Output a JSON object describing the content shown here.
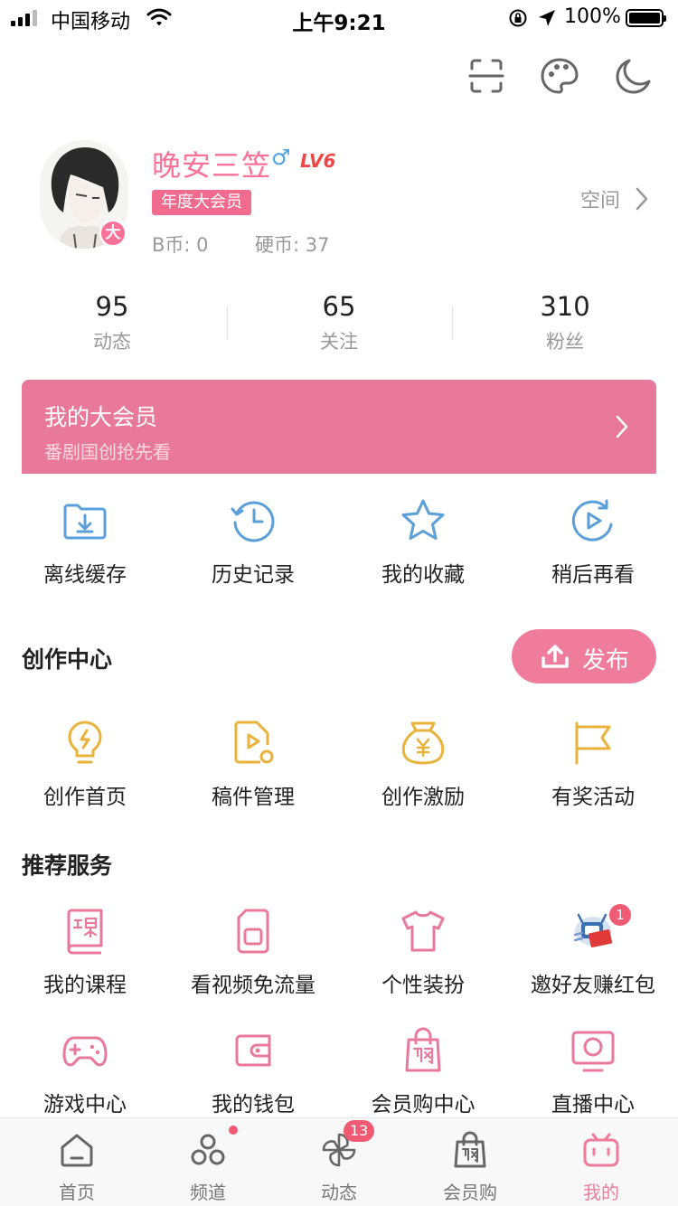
{
  "status_bar": {
    "carrier": "中国移动",
    "time": "上午9:21",
    "battery": "100%"
  },
  "profile": {
    "username": "晚安三笠",
    "gender_symbol": "♂",
    "level": "LV6",
    "vip_tag": "年度大会员",
    "avatar_badge": "大",
    "b_coin": "B币: 0",
    "hard_coin": "硬币: 37",
    "space_link": "空间"
  },
  "stats": [
    {
      "num": "95",
      "label": "动态"
    },
    {
      "num": "65",
      "label": "关注"
    },
    {
      "num": "310",
      "label": "粉丝"
    }
  ],
  "vip_banner": {
    "title": "我的大会员",
    "subtitle": "番剧国创抢先看"
  },
  "quick_actions": [
    {
      "label": "离线缓存",
      "icon": "download-folder-icon"
    },
    {
      "label": "历史记录",
      "icon": "history-clock-icon"
    },
    {
      "label": "我的收藏",
      "icon": "star-icon"
    },
    {
      "label": "稍后再看",
      "icon": "watch-later-icon"
    }
  ],
  "creation": {
    "title": "创作中心",
    "publish_label": "发布",
    "items": [
      {
        "label": "创作首页",
        "icon": "lightbulb-icon"
      },
      {
        "label": "稿件管理",
        "icon": "video-file-icon"
      },
      {
        "label": "创作激励",
        "icon": "money-bag-icon"
      },
      {
        "label": "有奖活动",
        "icon": "flag-icon"
      }
    ]
  },
  "services": {
    "title": "推荐服务",
    "items": [
      {
        "label": "我的课程",
        "icon": "course-book-icon"
      },
      {
        "label": "看视频免流量",
        "icon": "sim-card-icon"
      },
      {
        "label": "个性装扮",
        "icon": "tshirt-icon"
      },
      {
        "label": "邀好友赚红包",
        "icon": "red-envelope-icon",
        "badge": "1"
      },
      {
        "label": "游戏中心",
        "icon": "gamepad-icon"
      },
      {
        "label": "我的钱包",
        "icon": "wallet-icon"
      },
      {
        "label": "会员购中心",
        "icon": "shopping-bag-icon"
      },
      {
        "label": "直播中心",
        "icon": "live-tv-icon"
      }
    ]
  },
  "tabbar": {
    "items": [
      {
        "label": "首页",
        "icon": "home-icon"
      },
      {
        "label": "频道",
        "icon": "channel-icon"
      },
      {
        "label": "动态",
        "icon": "pinwheel-icon",
        "count": "13"
      },
      {
        "label": "会员购",
        "icon": "shopping-bag-icon"
      },
      {
        "label": "我的",
        "icon": "tv-icon"
      }
    ],
    "active_index": 4
  },
  "colors": {
    "accent_pink": "#fb7299",
    "banner_pink": "#e8799a",
    "blue_icon": "#5a9fd8",
    "gold_icon": "#e9b23a",
    "gender_blue": "#4fa3e0"
  }
}
